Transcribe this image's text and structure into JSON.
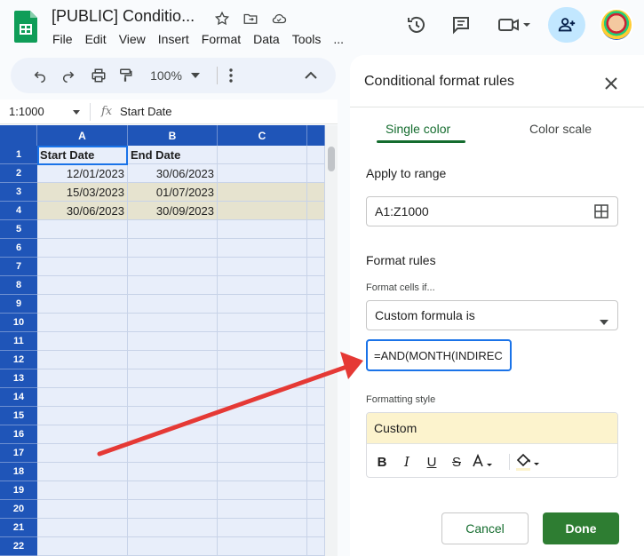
{
  "app": {
    "doc_title": "[PUBLIC] Conditio...",
    "menu": [
      "File",
      "Edit",
      "View",
      "Insert",
      "Format",
      "Data",
      "Tools",
      "..."
    ]
  },
  "toolbar": {
    "zoom": "100%"
  },
  "formula_bar": {
    "name_box": "1:1000",
    "fx_label": "fx",
    "value": "Start Date"
  },
  "sheet": {
    "columns": [
      "A",
      "B",
      "C"
    ],
    "rows": [
      "1",
      "2",
      "3",
      "4",
      "5",
      "6",
      "7",
      "8",
      "9",
      "10",
      "11",
      "12",
      "13",
      "14",
      "15",
      "16",
      "17",
      "18",
      "19",
      "20",
      "21",
      "22"
    ],
    "data": [
      {
        "a": "Start Date",
        "b": "End Date",
        "highlight": false,
        "header": true
      },
      {
        "a": "12/01/2023",
        "b": "30/06/2023",
        "highlight": false,
        "header": false
      },
      {
        "a": "15/03/2023",
        "b": "01/07/2023",
        "highlight": true,
        "header": false
      },
      {
        "a": "30/06/2023",
        "b": "30/09/2023",
        "highlight": true,
        "header": false
      }
    ]
  },
  "panel": {
    "title": "Conditional format rules",
    "tabs": [
      "Single color",
      "Color scale"
    ],
    "apply_to_range_label": "Apply to range",
    "range_value": "A1:Z1000",
    "format_rules_label": "Format rules",
    "format_cells_if_label": "Format cells if...",
    "condition_value": "Custom formula is",
    "formula_value": "=AND(MONTH(INDIREC",
    "formatting_style_label": "Formatting style",
    "style_preview": "Custom",
    "cancel_label": "Cancel",
    "done_label": "Done"
  },
  "colors": {
    "header_blue": "#1f55b8",
    "highlight_row": "#e6e3cf",
    "accent_green": "#146c2e",
    "arrow_red": "#e53935"
  }
}
